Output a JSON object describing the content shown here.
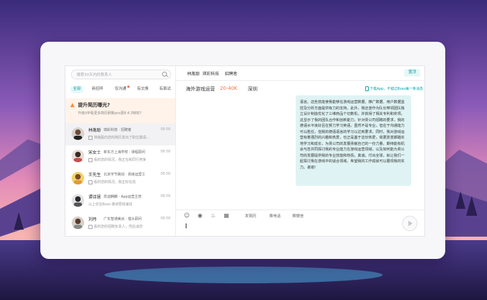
{
  "colors": {
    "accent": "#00a6a7",
    "salary": "#ff6b3d",
    "bubble": "#dff3f4",
    "banner": "#fff3ea"
  },
  "search": {
    "placeholder": "搜索30天内的联系人",
    "icon": "search-icon"
  },
  "filters": [
    {
      "label": "全部",
      "active": true
    },
    {
      "label": "新招呼",
      "active": false
    },
    {
      "label": "仅沟通",
      "active": false,
      "dot": true
    },
    {
      "label": "有交换",
      "active": false
    },
    {
      "label": "有面试",
      "active": false
    }
  ],
  "banner": {
    "icon": "flame-icon",
    "title": "提升简历曝光?",
    "subtitle": "升级VIP看更多简历刷新pro更8.4.3特权?"
  },
  "contacts": [
    {
      "name": "林胤聪",
      "company": "琪彩科技 · 招聘者",
      "time": "08:58",
      "status": "",
      "preview": "林胤聪向您的简历发出了职位邀请...",
      "selected": true
    },
    {
      "name": "宋女士",
      "company": "新东方上海学校 · 课程顾问",
      "time": "08:58",
      "status": "",
      "preview": "看的您的情况，我正在和同行竞争",
      "selected": false
    },
    {
      "name": "王先生",
      "company": "北京字节跳动 · 高级运营工",
      "time": "08:58",
      "status": "",
      "preview": "看的您的情况，我正好在找",
      "selected": false
    },
    {
      "name": "谭诗慧",
      "company": "凯迪麒麟 · App运营主管",
      "time": "08:58",
      "status": "",
      "preview": "以上仅在Boss·谭诗慧快速找",
      "selected": false
    },
    {
      "name": "刘丹",
      "company": "广东智通美派 · 猎头顾问",
      "time": "08:58",
      "status": "",
      "preview": "看的您的招聘负责人，然后谈您",
      "selected": false
    }
  ],
  "chat": {
    "header": {
      "name": "林胤聪",
      "company": "琪彩科技",
      "title": "招聘者",
      "button": "置顶"
    },
    "job": {
      "name": "海外游戏运营",
      "salary": "20-40K",
      "city": "深圳",
      "app_hint": "下载App，不错过Boss每一条消息"
    },
    "message": "语言。这些技能使我能够在游戏运营数据、推广数据、用户数据监控及分析方面提供有力的支持。此外，我还曾作为队长带领团队独立设计制造优化了三维商品个切数机，并获得了相关专利和奖项。这显示了我的团队合作和创新能力。针对贵公司招聘的要求，我的德语水平良好且在努力学习英语，虽然不是专业，但在于沟通能力可以胜任，但我的德语语言的学习以达到要求。同时，我对游戏运营有着强烈的兴趣和热爱，也正是基于这份热爱，我更愿意脚踏实地学习和成长，为贵公司的发展贡献自己的一份力量。期待能有机会与您共同探讨我的专业能力在游戏运营领域，以及如何能为贵公司的发展提供我的专业技能和热情。真诚，付出全球，就让我们一起探讨我在游戏中的适合领域，希望我的工作成就可以展现我的实力。谢谢！",
    "tools": [
      {
        "icon": "emoji-icon"
      },
      {
        "icon": "quick-reply-icon"
      },
      {
        "icon": "bell-icon"
      },
      {
        "icon": "image-icon"
      }
    ],
    "actions": [
      "发简历",
      "换电话",
      "换微信"
    ]
  }
}
